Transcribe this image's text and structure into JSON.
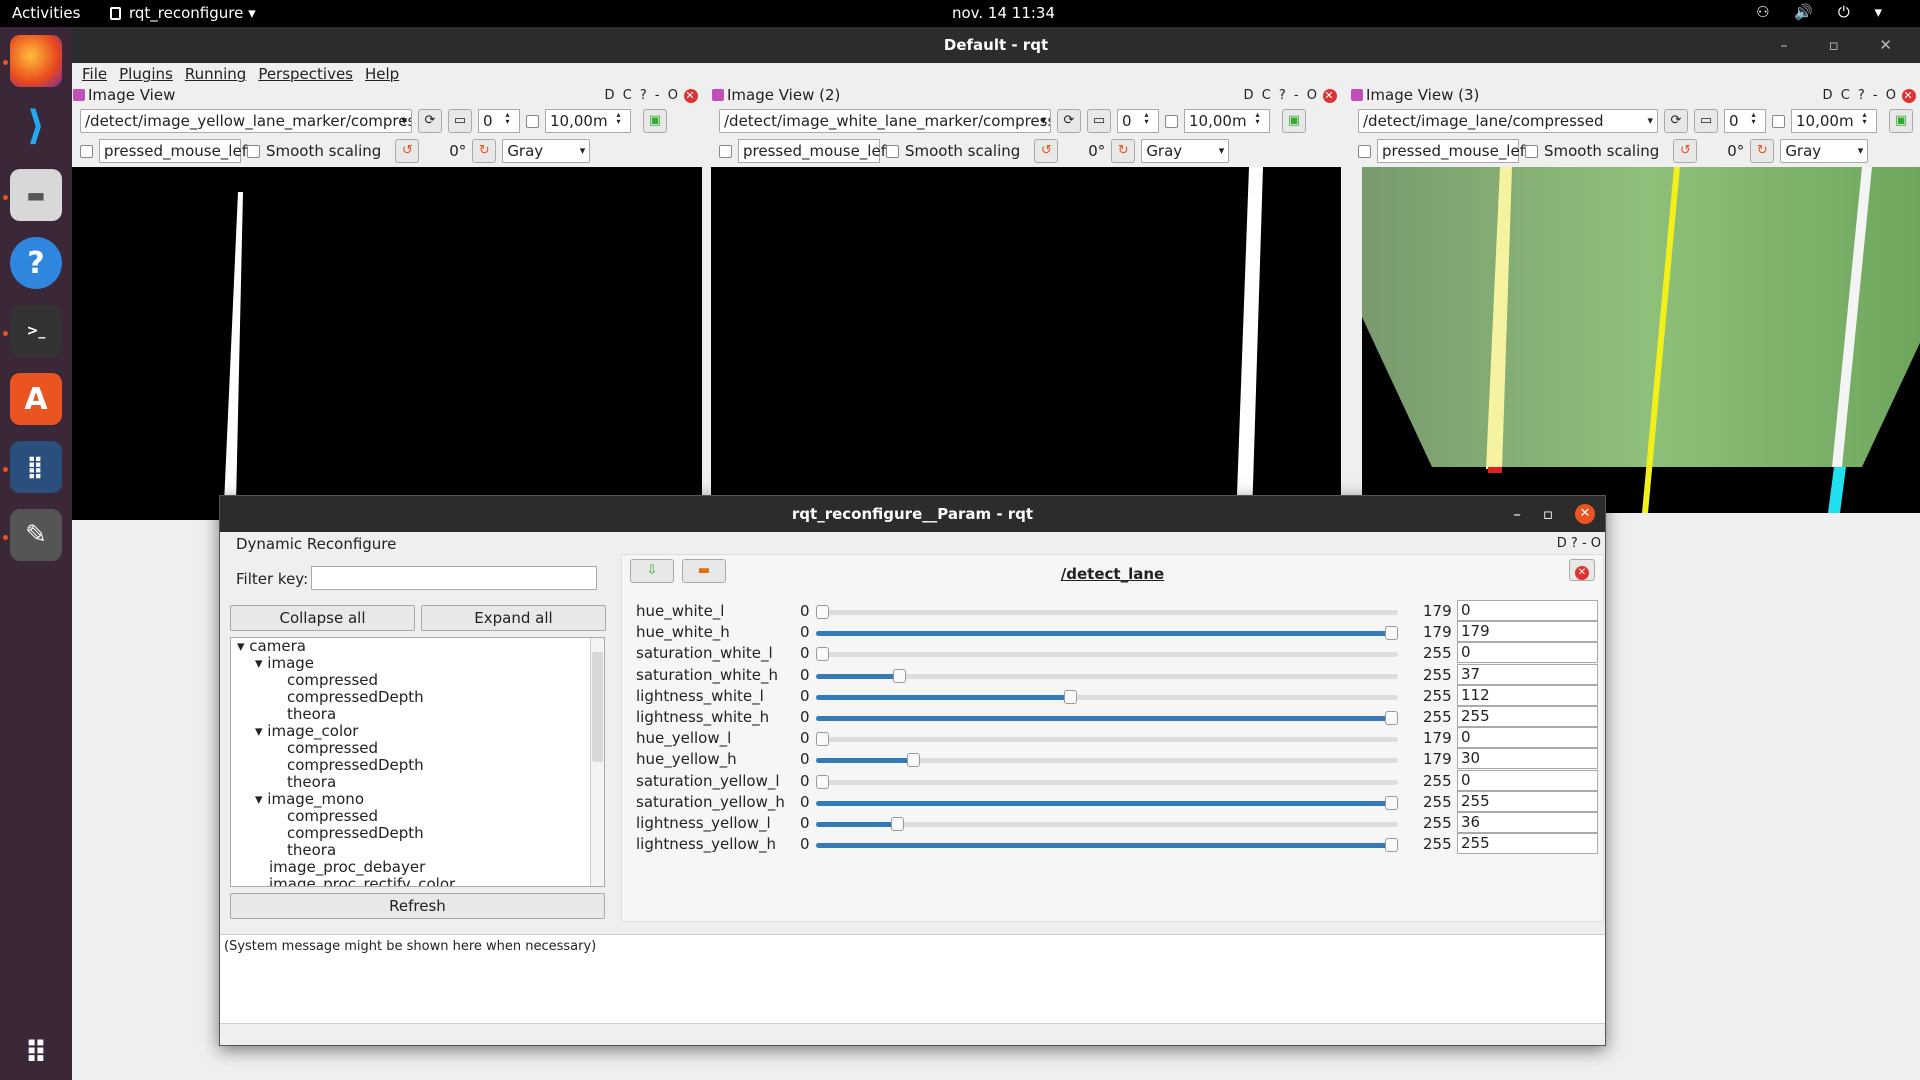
{
  "topbar": {
    "activities": "Activities",
    "app": "rqt_reconfigure ▾",
    "clock": "nov. 14  11:34",
    "tray": "⚇ 🔊 ⏻ ▾"
  },
  "dock": [
    "firefox-icon",
    "vscode-icon",
    "files-icon",
    "help-icon",
    "terminal-icon",
    "appstore-icon",
    "apps-icon",
    "editor-icon"
  ],
  "main": {
    "title": "Default - rqt",
    "wc": "–  ▫  ✕"
  },
  "menu": [
    "File",
    "Plugins",
    "Running",
    "Perspectives",
    "Help"
  ],
  "views": [
    {
      "title": "Image View",
      "topic": "/detect/image_yellow_lane_marker/compres",
      "spin": "0",
      "zoom": "10,00m",
      "mouse": "pressed_mouse_left",
      "smooth": "Smooth scaling",
      "rot": "0°",
      "color": "Gray",
      "ctl": "D C ?  - O"
    },
    {
      "title": "Image View (2)",
      "topic": "/detect/image_white_lane_marker/compress",
      "spin": "0",
      "zoom": "10,00m",
      "mouse": "pressed_mouse_left",
      "smooth": "Smooth scaling",
      "rot": "0°",
      "color": "Gray",
      "ctl": "D C ?  - O"
    },
    {
      "title": "Image View (3)",
      "topic": "/detect/image_lane/compressed",
      "spin": "0",
      "zoom": "10,00m",
      "mouse": "pressed_mouse_left",
      "smooth": "Smooth scaling",
      "rot": "0°",
      "color": "Gray",
      "ctl": "D C ?  - O"
    }
  ],
  "dialog": {
    "title": "rqt_reconfigure__Param - rqt",
    "min": "–",
    "max": "▫",
    "close": "✕",
    "dr": "Dynamic Reconfigure",
    "drctl": "D ?  - O",
    "filter": "Filter key:",
    "collapse": "Collapse all",
    "expand": "Expand all",
    "refresh": "Refresh",
    "tree": [
      {
        "t": "▾ camera",
        "i": 0
      },
      {
        "t": "▾ image",
        "i": 1
      },
      {
        "t": "compressed",
        "i": 2
      },
      {
        "t": "compressedDepth",
        "i": 2
      },
      {
        "t": "theora",
        "i": 2
      },
      {
        "t": "▾ image_color",
        "i": 1
      },
      {
        "t": "compressed",
        "i": 2
      },
      {
        "t": "compressedDepth",
        "i": 2
      },
      {
        "t": "theora",
        "i": 2
      },
      {
        "t": "▾ image_mono",
        "i": 1
      },
      {
        "t": "compressed",
        "i": 2
      },
      {
        "t": "compressedDepth",
        "i": 2
      },
      {
        "t": "theora",
        "i": 2
      },
      {
        "t": "image_proc_debayer",
        "i": 1
      },
      {
        "t": "image_proc_rectify_color",
        "i": 1
      }
    ],
    "node": "/detect_lane",
    "params": [
      {
        "name": "hue_white_l",
        "min": "0",
        "max": "179",
        "value": "0",
        "f": 0
      },
      {
        "name": "hue_white_h",
        "min": "0",
        "max": "179",
        "value": "179",
        "f": 1
      },
      {
        "name": "saturation_white_l",
        "min": "0",
        "max": "255",
        "value": "0",
        "f": 0
      },
      {
        "name": "saturation_white_h",
        "min": "0",
        "max": "255",
        "value": "37",
        "f": 0.145
      },
      {
        "name": "lightness_white_l",
        "min": "0",
        "max": "255",
        "value": "112",
        "f": 0.439
      },
      {
        "name": "lightness_white_h",
        "min": "0",
        "max": "255",
        "value": "255",
        "f": 1
      },
      {
        "name": "hue_yellow_l",
        "min": "0",
        "max": "179",
        "value": "0",
        "f": 0
      },
      {
        "name": "hue_yellow_h",
        "min": "0",
        "max": "179",
        "value": "30",
        "f": 0.168
      },
      {
        "name": "saturation_yellow_l",
        "min": "0",
        "max": "255",
        "value": "0",
        "f": 0
      },
      {
        "name": "saturation_yellow_h",
        "min": "0",
        "max": "255",
        "value": "255",
        "f": 1
      },
      {
        "name": "lightness_yellow_l",
        "min": "0",
        "max": "255",
        "value": "36",
        "f": 0.141
      },
      {
        "name": "lightness_yellow_h",
        "min": "0",
        "max": "255",
        "value": "255",
        "f": 1
      }
    ],
    "msg": "(System message might be shown here when necessary)"
  }
}
